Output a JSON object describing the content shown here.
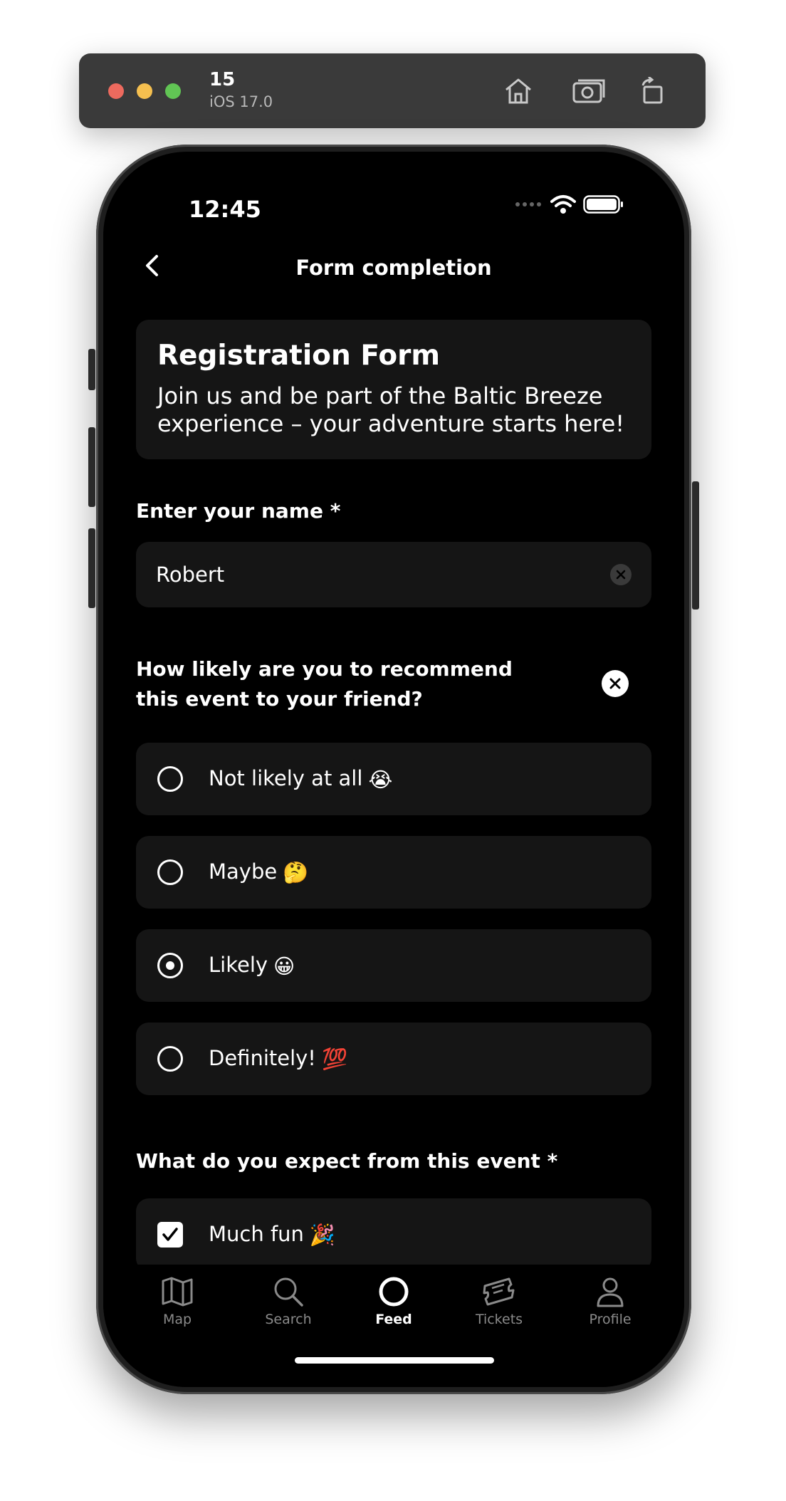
{
  "simulator": {
    "device_name": "15",
    "os_version": "iOS 17.0",
    "buttons": [
      "home-icon",
      "screenshot-icon",
      "rotate-icon"
    ]
  },
  "status_bar": {
    "time": "12:45"
  },
  "nav": {
    "title": "Form completion"
  },
  "intro": {
    "title": "Registration Form",
    "description": " Join us and be part of the Baltic Breeze experience – your adventure starts here!"
  },
  "name_question": {
    "label": "Enter your name *",
    "value": "Robert"
  },
  "recommend_question": {
    "label": "How likely are you to recommend this event to your friend?",
    "options": [
      {
        "label": "Not likely at all",
        "emoji": "😭",
        "selected": false
      },
      {
        "label": "Maybe",
        "emoji": "🤔",
        "selected": false
      },
      {
        "label": "Likely",
        "emoji": "😀",
        "selected": true
      },
      {
        "label": "Definitely!",
        "emoji": "💯",
        "selected": false
      }
    ]
  },
  "expect_question": {
    "label": "What do you expect from this event *",
    "options": [
      {
        "label": "Much fun",
        "emoji": "🎉",
        "checked": true
      }
    ]
  },
  "tab_bar": {
    "tabs": [
      {
        "label": "Map",
        "icon": "map-icon",
        "active": false
      },
      {
        "label": "Search",
        "icon": "search-icon",
        "active": false
      },
      {
        "label": "Feed",
        "icon": "feed-icon",
        "active": true
      },
      {
        "label": "Tickets",
        "icon": "ticket-icon",
        "active": false
      },
      {
        "label": "Profile",
        "icon": "profile-icon",
        "active": false
      }
    ]
  },
  "colors": {
    "background": "#000000",
    "card": "#151515",
    "text": "#ffffff",
    "inactive_tab": "#8a8a8a"
  }
}
